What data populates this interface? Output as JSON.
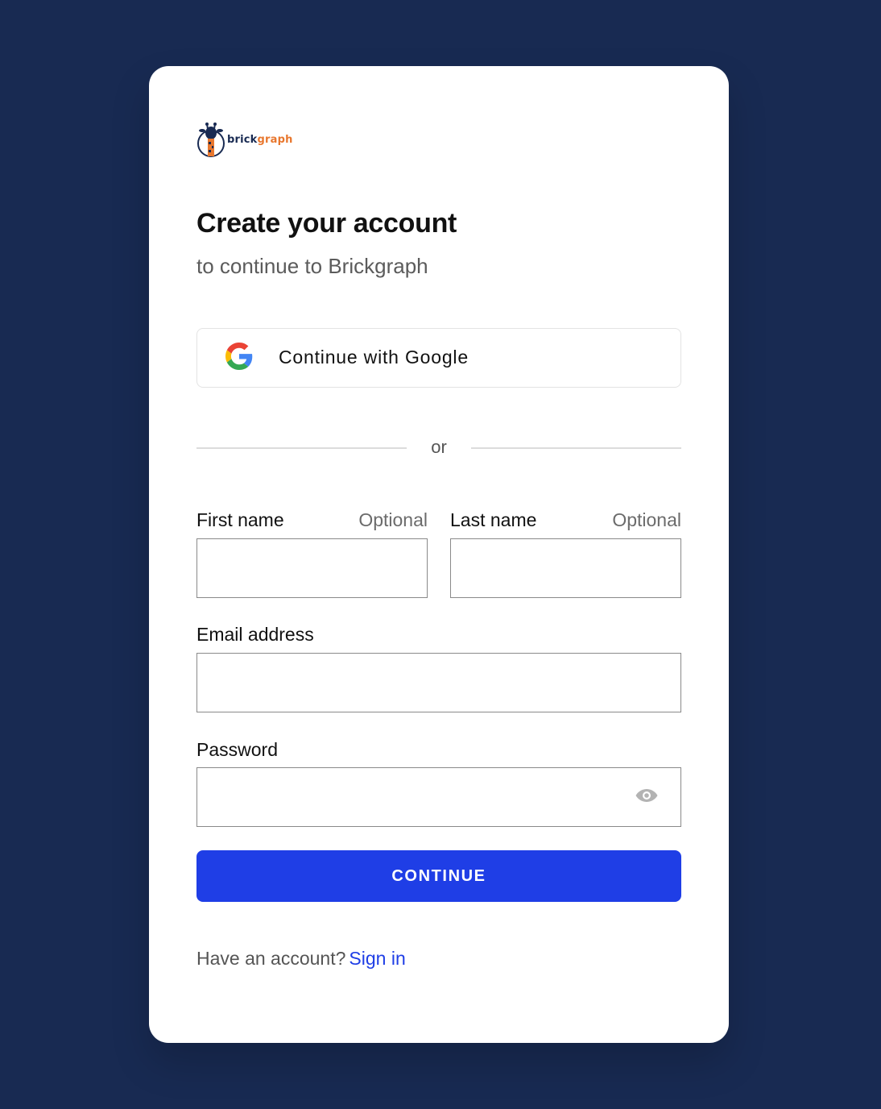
{
  "brand": {
    "logo_text_dark": "brick",
    "logo_text_accent": "graph",
    "dark_color": "#182a52",
    "accent_color": "#e8772e"
  },
  "page": {
    "background_color": "#182a52",
    "title": "Create your account",
    "subtitle": "to continue to Brickgraph"
  },
  "google_button": {
    "label": "Continue with Google",
    "icon": "google-icon"
  },
  "divider": {
    "text": "or"
  },
  "form": {
    "first_name": {
      "label": "First name",
      "optional": "Optional",
      "value": ""
    },
    "last_name": {
      "label": "Last name",
      "optional": "Optional",
      "value": ""
    },
    "email": {
      "label": "Email address",
      "value": ""
    },
    "password": {
      "label": "Password",
      "value": "",
      "toggle_icon": "eye-icon"
    },
    "submit_label": "CONTINUE",
    "submit_color": "#1f3ee6"
  },
  "footer": {
    "prompt": "Have an account?",
    "link_label": "Sign in"
  }
}
